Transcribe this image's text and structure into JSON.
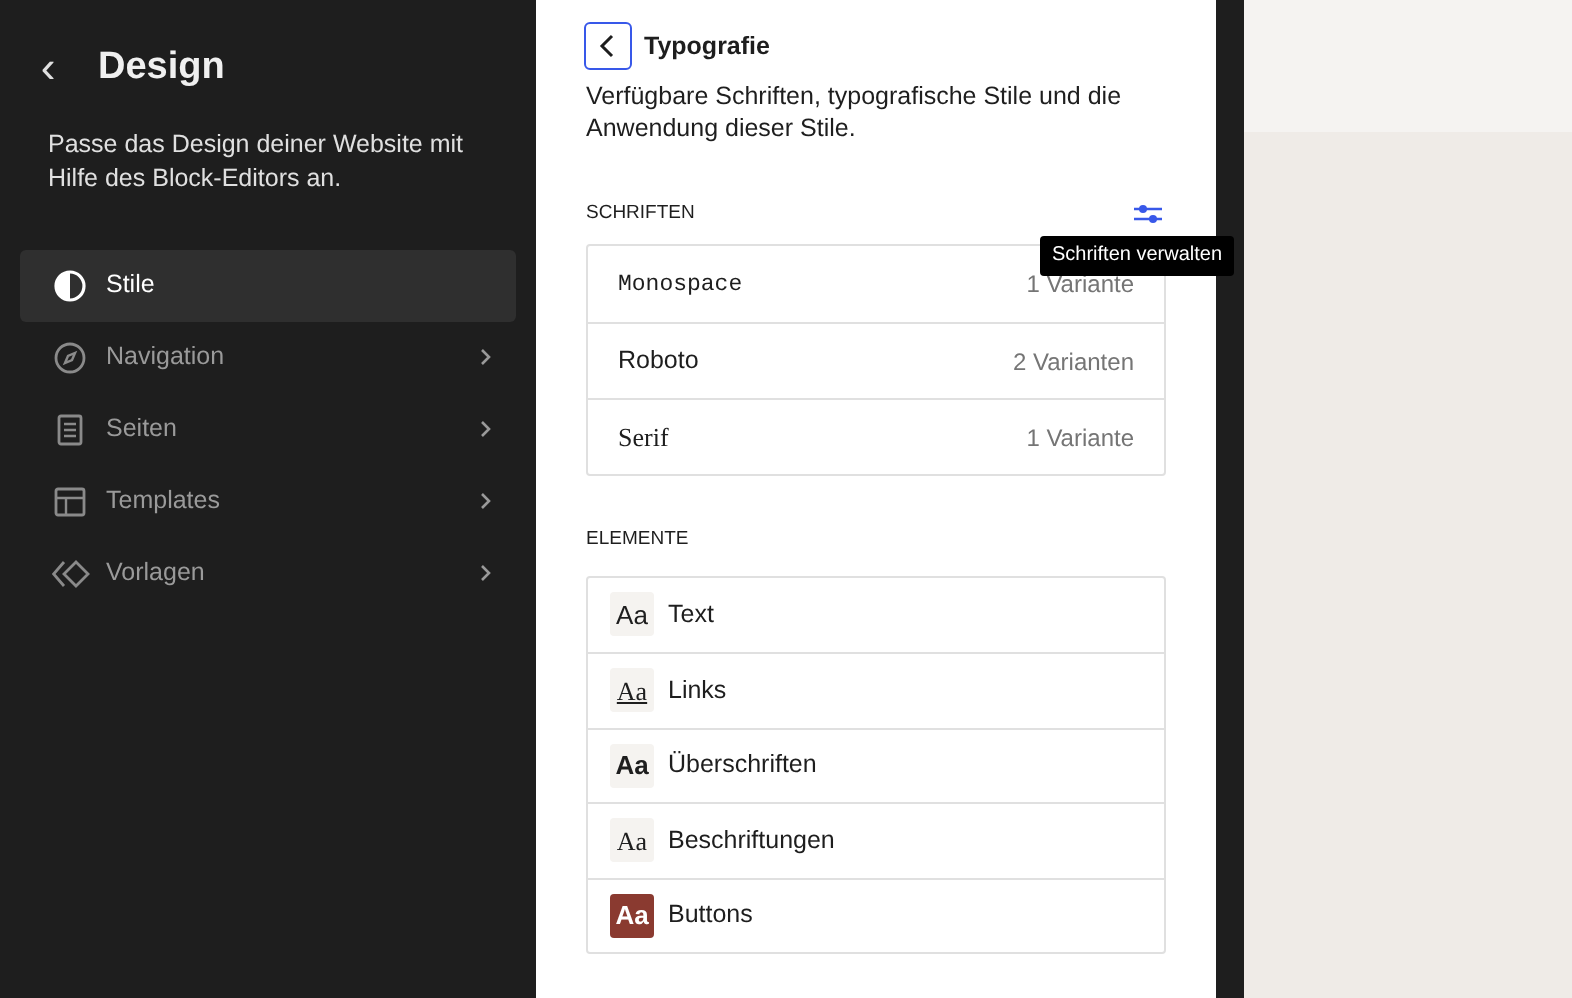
{
  "sidebar": {
    "back": "‹",
    "title": "Design",
    "description": "Passe das Design deiner Website mit Hilfe des Block-Editors an.",
    "items": [
      {
        "label": "Stile",
        "selected": true,
        "chevron": false
      },
      {
        "label": "Navigation",
        "selected": false,
        "chevron": true
      },
      {
        "label": "Seiten",
        "selected": false,
        "chevron": true
      },
      {
        "label": "Templates",
        "selected": false,
        "chevron": true
      },
      {
        "label": "Vorlagen",
        "selected": false,
        "chevron": true
      }
    ]
  },
  "panel": {
    "title": "Typografie",
    "description": "Verfügbare Schriften, typografische Stile und die Anwendung dieser Stile.",
    "fonts_heading": "SCHRIFTEN",
    "tooltip": "Schriften verwalten",
    "fonts": [
      {
        "name": "Monospace",
        "kind": "mono",
        "variants": "1 Variante"
      },
      {
        "name": "Roboto",
        "kind": "sans",
        "variants": "2 Varianten"
      },
      {
        "name": "Serif",
        "kind": "serif",
        "variants": "1 Variante"
      }
    ],
    "elements_heading": "ELEMENTE",
    "elements": [
      {
        "label": "Text",
        "kind": "text",
        "preview": "Aa"
      },
      {
        "label": "Links",
        "kind": "link",
        "preview": "Aa"
      },
      {
        "label": "Überschriften",
        "kind": "heading",
        "preview": "Aa"
      },
      {
        "label": "Beschriftungen",
        "kind": "caption",
        "preview": "Aa"
      },
      {
        "label": "Buttons",
        "kind": "button",
        "preview": "Aa"
      }
    ]
  }
}
